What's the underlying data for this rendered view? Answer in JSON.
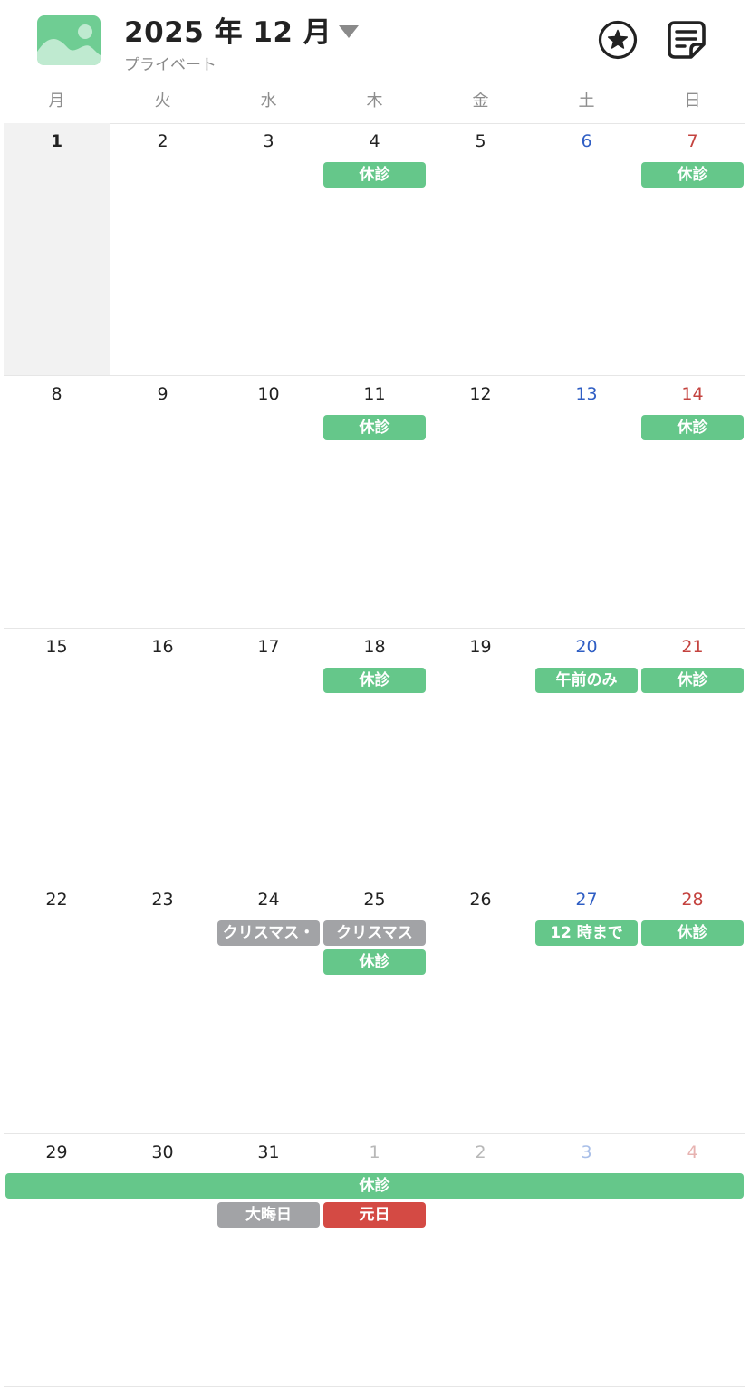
{
  "header": {
    "title": "2025 年 12 月",
    "calendar_name": "プライベート"
  },
  "colors": {
    "accent_green": "#65c78a",
    "holiday_gray": "#a2a3a6",
    "holiday_red": "#d44a44",
    "saturday_blue": "#2f5ec4",
    "sunday_red": "#c4433f"
  },
  "icons": {
    "app": "image-photo-icon",
    "favorite": "star-circle-icon",
    "notes": "note-list-icon",
    "title_dropdown": "triangle-down-icon"
  },
  "weekdays": [
    "月",
    "火",
    "水",
    "木",
    "金",
    "土",
    "日"
  ],
  "weeks": [
    {
      "days": [
        {
          "num": "1",
          "today": true
        },
        {
          "num": "2"
        },
        {
          "num": "3"
        },
        {
          "num": "4"
        },
        {
          "num": "5"
        },
        {
          "num": "6",
          "type": "sat"
        },
        {
          "num": "7",
          "type": "sun"
        }
      ],
      "events": [
        {
          "label": "休診",
          "col": 3,
          "span": 1,
          "row": 0,
          "color": "green"
        },
        {
          "label": "休診",
          "col": 6,
          "span": 1,
          "row": 0,
          "color": "green"
        }
      ]
    },
    {
      "days": [
        {
          "num": "8"
        },
        {
          "num": "9"
        },
        {
          "num": "10"
        },
        {
          "num": "11"
        },
        {
          "num": "12"
        },
        {
          "num": "13",
          "type": "sat"
        },
        {
          "num": "14",
          "type": "sun"
        }
      ],
      "events": [
        {
          "label": "休診",
          "col": 3,
          "span": 1,
          "row": 0,
          "color": "green"
        },
        {
          "label": "休診",
          "col": 6,
          "span": 1,
          "row": 0,
          "color": "green"
        }
      ]
    },
    {
      "days": [
        {
          "num": "15"
        },
        {
          "num": "16"
        },
        {
          "num": "17"
        },
        {
          "num": "18"
        },
        {
          "num": "19"
        },
        {
          "num": "20",
          "type": "sat"
        },
        {
          "num": "21",
          "type": "sun"
        }
      ],
      "events": [
        {
          "label": "休診",
          "col": 3,
          "span": 1,
          "row": 0,
          "color": "green"
        },
        {
          "label": "午前のみ",
          "col": 5,
          "span": 1,
          "row": 0,
          "color": "green"
        },
        {
          "label": "休診",
          "col": 6,
          "span": 1,
          "row": 0,
          "color": "green"
        }
      ]
    },
    {
      "days": [
        {
          "num": "22"
        },
        {
          "num": "23"
        },
        {
          "num": "24"
        },
        {
          "num": "25"
        },
        {
          "num": "26"
        },
        {
          "num": "27",
          "type": "sat"
        },
        {
          "num": "28",
          "type": "sun"
        }
      ],
      "events": [
        {
          "label": "クリスマス・",
          "col": 2,
          "span": 1,
          "row": 0,
          "color": "gray"
        },
        {
          "label": "クリスマス",
          "col": 3,
          "span": 1,
          "row": 0,
          "color": "gray"
        },
        {
          "label": "休診",
          "col": 3,
          "span": 1,
          "row": 1,
          "color": "green"
        },
        {
          "label": "12 時まで",
          "col": 5,
          "span": 1,
          "row": 0,
          "color": "green"
        },
        {
          "label": "休診",
          "col": 6,
          "span": 1,
          "row": 0,
          "color": "green"
        }
      ]
    },
    {
      "days": [
        {
          "num": "29"
        },
        {
          "num": "30"
        },
        {
          "num": "31"
        },
        {
          "num": "1",
          "other": true
        },
        {
          "num": "2",
          "other": true
        },
        {
          "num": "3",
          "type": "sat",
          "other": true
        },
        {
          "num": "4",
          "type": "sun",
          "other": true
        }
      ],
      "events": [
        {
          "label": "休診",
          "col": 0,
          "span": 7,
          "row": 0,
          "color": "green"
        },
        {
          "label": "大晦日",
          "col": 2,
          "span": 1,
          "row": 1,
          "color": "gray"
        },
        {
          "label": "元日",
          "col": 3,
          "span": 1,
          "row": 1,
          "color": "red"
        }
      ]
    }
  ]
}
